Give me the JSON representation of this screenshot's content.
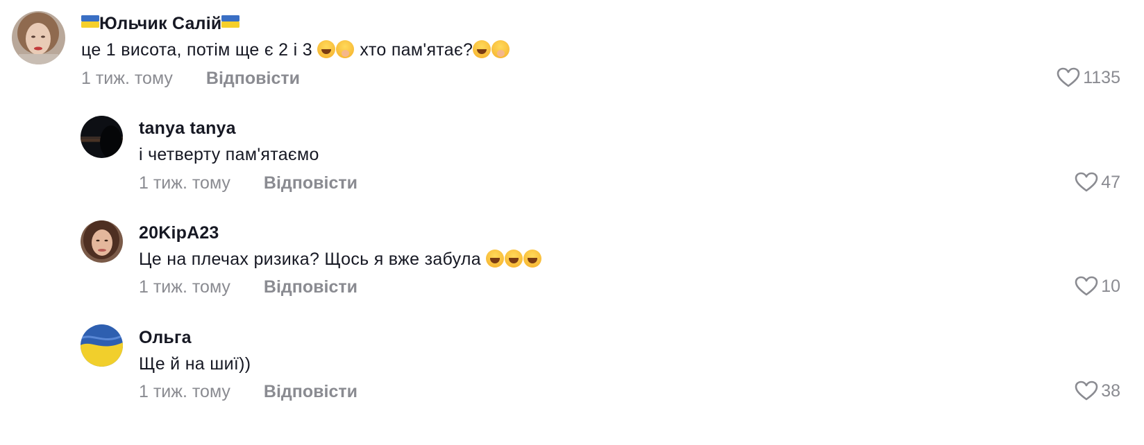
{
  "comments": [
    {
      "username": "Юльчик Салій",
      "text": "це 1 висота, потім ще є 2 і 3",
      "text_tail": "хто пам'ятає?",
      "time": "1 тиж. тому",
      "reply_label": "Відповісти",
      "likes": "1135"
    },
    {
      "username": "tanya tanya",
      "text": "і четверту пам'ятаємо",
      "time": "1 тиж. тому",
      "reply_label": "Відповісти",
      "likes": "47"
    },
    {
      "username": "20KipA23",
      "text": "Це на плечах ризика? Щось я вже забула",
      "time": "1 тиж. тому",
      "reply_label": "Відповісти",
      "likes": "10"
    },
    {
      "username": "Ольга",
      "text": "Ще й на шиї))",
      "time": "1 тиж. тому",
      "reply_label": "Відповісти",
      "likes": "38"
    }
  ],
  "icons": {
    "like": "heart-outline-icon",
    "flag": "ukraine-flag-icon",
    "emoji_laugh": "face-with-tears-of-joy-icon",
    "emoji_hush": "face-with-hand-over-mouth-icon",
    "emoji_grin": "grinning-squinting-face-icon"
  },
  "colors": {
    "text": "#161823",
    "muted": "#8a8b91",
    "flag_blue": "#3a6fc4",
    "flag_yellow": "#f5cf2a"
  }
}
